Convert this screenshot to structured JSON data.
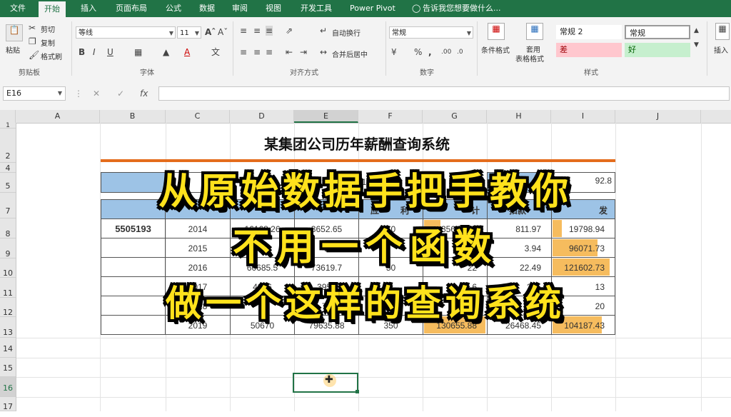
{
  "ribbon_tabs": [
    "文件",
    "开始",
    "插入",
    "页面布局",
    "公式",
    "数据",
    "审阅",
    "视图",
    "开发工具",
    "Power Pivot"
  ],
  "tell_me": "告诉我您想要做什么...",
  "clipboard": {
    "paste": "粘贴",
    "cut": "剪切",
    "copy": "复制",
    "format_painter": "格式刷",
    "group": "剪贴板"
  },
  "font": {
    "name": "等线",
    "size": "11",
    "bold": "B",
    "italic": "I",
    "underline": "U",
    "group": "字体"
  },
  "alignment": {
    "wrap": "自动换行",
    "merge": "合并后居中",
    "group": "对齐方式"
  },
  "number": {
    "format": "常规",
    "group": "数字"
  },
  "styles": {
    "conditional": "条件格式",
    "table_line1": "套用",
    "table_line2": "表格格式",
    "normal2": "常规 2",
    "normal": "常规",
    "bad": "差",
    "good": "好",
    "group": "样式"
  },
  "insert_cells": "插入",
  "name_box": "E16",
  "formula": "",
  "columns": [
    "A",
    "B",
    "C",
    "D",
    "E",
    "F",
    "G",
    "H",
    "I",
    "J"
  ],
  "rows": [
    "1",
    "2",
    "4",
    "5",
    "7",
    "8",
    "9",
    "10",
    "11",
    "12",
    "13",
    "14",
    "15",
    "16",
    "17"
  ],
  "report": {
    "title": "某集团公司历年薪酬查询系统",
    "partial_5": [
      "019",
      "发",
      "92.8"
    ],
    "partial_7": [
      "应",
      "利",
      "计",
      "扣款",
      "发"
    ],
    "id": "5505193",
    "years": [
      "2014",
      "2015",
      "2016",
      "2017",
      "2018",
      "2019"
    ],
    "col_d": [
      "16168.26",
      "",
      "60685.5",
      "4826",
      "",
      "50670"
    ],
    "col_e": [
      "3652.65",
      "45",
      "73619.7",
      "3957",
      "74",
      "79635.88"
    ],
    "col_f": [
      "50",
      "",
      "50",
      "",
      "",
      "350"
    ],
    "col_g": [
      "35610.91",
      "",
      "22",
      "6",
      "8.9",
      "130655.88"
    ],
    "col_h": [
      "811.97",
      "3.94",
      "22.49",
      "265",
      "",
      "26468.45"
    ],
    "col_i": [
      "19798.94",
      "96071.73",
      "121602.73",
      "13",
      "20",
      "104187.43"
    ]
  },
  "chart_data": {
    "type": "bar",
    "categories": [
      "2014",
      "2015",
      "2016",
      "2017",
      "2018",
      "2019"
    ],
    "series": [
      {
        "values": [
          35610.91,
          null,
          null,
          null,
          null,
          130655.88
        ]
      },
      {
        "values": [
          19798.94,
          96071.73,
          121602.73,
          null,
          null,
          104187.43
        ]
      }
    ]
  },
  "captions": [
    "从原始数据手把手教你",
    "不用一个函数",
    "做一个这样的查询系统"
  ],
  "accent": "#217346",
  "header_blue": "#9dc3e6",
  "bar_orange": "#f5b54c",
  "caption_yellow": "#ffe21c"
}
